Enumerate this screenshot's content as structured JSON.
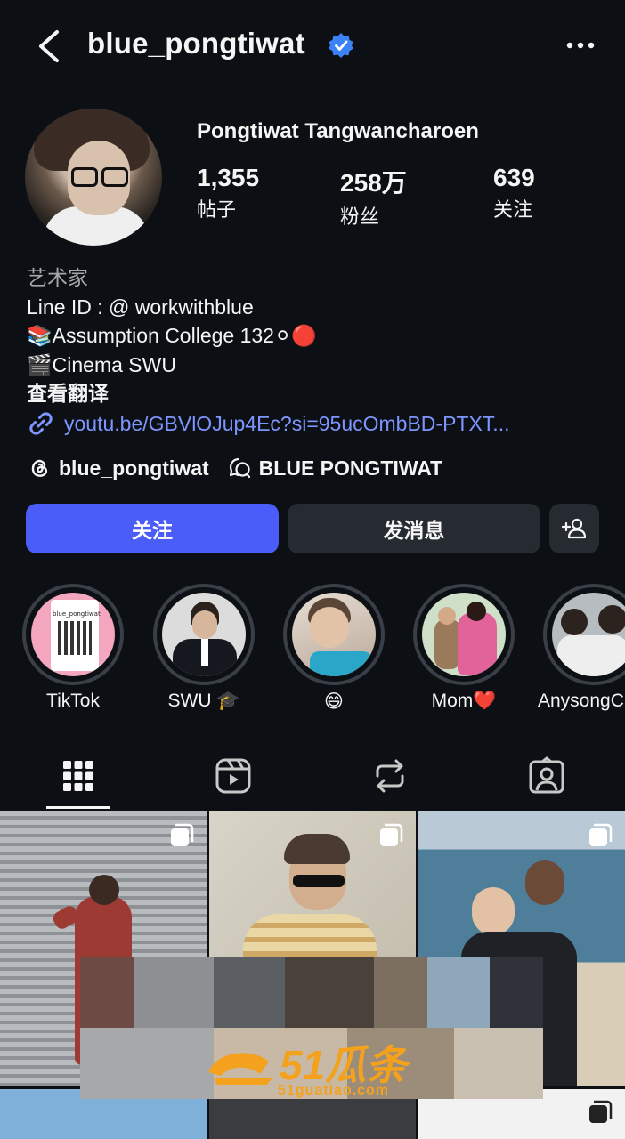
{
  "header": {
    "username": "blue_pongtiwat",
    "back_icon": "back-icon",
    "verified_icon": "verified-badge-icon",
    "more_icon": "more-icon"
  },
  "profile": {
    "full_name": "Pongtiwat Tangwancharoen",
    "stats": [
      {
        "value": "1,355",
        "label": "帖子"
      },
      {
        "value": "258万",
        "label": "粉丝"
      },
      {
        "value": "639",
        "label": "关注"
      }
    ],
    "category": "艺术家",
    "bio_lines": [
      "Line ID : @ workwithblue",
      "📚Assumption College 132⚪🔴",
      "🎬Cinema SWU"
    ],
    "translate_label": "查看翻译",
    "link": "youtu.be/GBVlOJup4Ec?si=95ucOmbBD-PTXT..."
  },
  "threads": {
    "handle": "blue_pongtiwat",
    "channel": "BLUE PONGTIWAT"
  },
  "actions": {
    "follow_label": "关注",
    "message_label": "发消息",
    "add_person_icon": "add-person-icon"
  },
  "highlights": [
    {
      "label": "TikTok"
    },
    {
      "label": "SWU 🎓"
    },
    {
      "label": "😄"
    },
    {
      "label": "Mom❤️"
    },
    {
      "label": "AnysongC"
    }
  ],
  "highlight_tiktok_caption": "blue_pongtiwat",
  "tabs": [
    {
      "icon": "grid-icon",
      "active": true
    },
    {
      "icon": "reels-icon",
      "active": false
    },
    {
      "icon": "reposts-icon",
      "active": false
    },
    {
      "icon": "tagged-icon",
      "active": false
    }
  ],
  "watermark": {
    "brand": "51瓜条",
    "domain": "51guatiao.com"
  },
  "colors": {
    "background": "#0c1014",
    "follow_button": "#4a5df9",
    "secondary_button": "#262a31",
    "link": "#7e95ff",
    "verified": "#3b82f6",
    "watermark": "#f4a21d"
  }
}
